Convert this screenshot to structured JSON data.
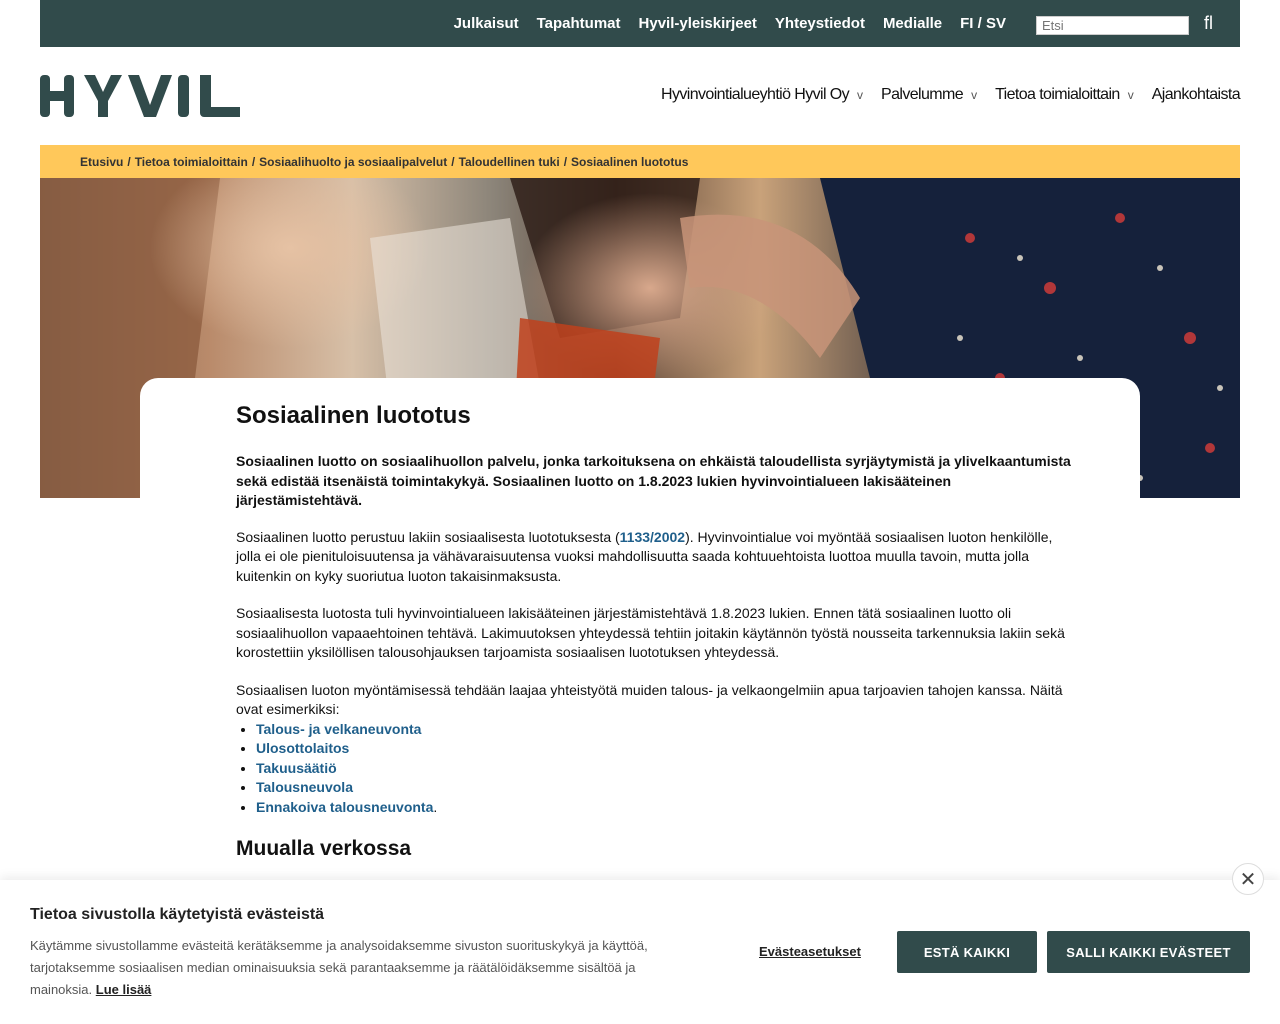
{
  "topnav": {
    "links": [
      "Julkaisut",
      "Tapahtumat",
      "Hyvil-yleiskirjeet",
      "Yhteystiedot",
      "Medialle"
    ],
    "lang_fi": "FI",
    "lang_sep": "/",
    "lang_sv": "SV",
    "search_placeholder": "Etsi",
    "search_icon": "fl"
  },
  "logo": {
    "text": "HYVIL",
    "color": "#314b4b"
  },
  "mainnav": {
    "items": [
      {
        "label": "Hyvinvointialueyhtiö Hyvil Oy",
        "chev": "v"
      },
      {
        "label": "Palvelumme",
        "chev": "v"
      },
      {
        "label": "Tietoa toimialoittain",
        "chev": "v"
      },
      {
        "label": "Ajankohtaista"
      }
    ]
  },
  "breadcrumb": {
    "items": [
      "Etusivu",
      "Tietoa toimialoittain",
      "Sosiaalihuolto ja sosiaalipalvelut",
      "Taloudellinen tuki",
      "Sosiaalinen luototus"
    ],
    "sep": "/"
  },
  "article": {
    "title": "Sosiaalinen luototus",
    "lead": "Sosiaalinen luotto on sosiaalihuollon palvelu, jonka tarkoituksena on ehkäistä taloudellista syrjäytymistä ja ylivelkaantumista sekä edistää itsenäistä toimintakykyä. Sosiaalinen luotto on 1.8.2023 lukien hyvinvointialueen lakisääteinen järjestämistehtävä.",
    "p1_before": "Sosiaalinen luotto perustuu lakiin sosiaalisesta luototuksesta (",
    "p1_link": "1133/2002",
    "p1_after": "). Hyvinvointialue voi myöntää sosiaalisen luoton henkilölle, jolla ei ole pienituloisuutensa ja vähävaraisuutensa vuoksi mahdollisuutta saada kohtuuehtoista luottoa muulla tavoin, mutta jolla kuitenkin on kyky suoriutua luoton takaisinmaksusta.",
    "p2": "Sosiaalisesta luotosta tuli hyvinvointialueen lakisääteinen järjestämistehtävä 1.8.2023 lukien. Ennen tätä sosiaalinen luotto oli sosiaalihuollon vapaaehtoinen tehtävä. Lakimuutoksen yhteydessä tehtiin joitakin käytännön työstä nousseita tarkennuksia lakiin sekä korostettiin yksilöllisen talousohjauksen tarjoamista sosiaalisen luototuksen yhteydessä.",
    "p3": "Sosiaalisen luoton myöntämisessä tehdään laajaa yhteistyötä muiden talous- ja velkaongelmiin apua tarjoavien tahojen kanssa.  Näitä ovat esimerkiksi:",
    "links": [
      "Talous- ja velkaneuvonta",
      "Ulosottolaitos",
      "Takuusäätiö",
      "Talousneuvola",
      "Ennakoiva talousneuvonta"
    ],
    "last_punct": ".",
    "h2": "Muualla verkossa"
  },
  "cookie": {
    "title": "Tietoa sivustolla käytetyistä evästeistä",
    "text": "Käytämme sivustollamme evästeitä kerätäksemme ja analysoidaksemme sivuston suorituskykyä ja käyttöä, tarjotaksemme sosiaalisen median ominaisuuksia sekä parantaaksemme ja räätälöidäksemme sisältöä ja mainoksia.",
    "more": "Lue lisää",
    "settings": "Evästeasetukset",
    "deny": "ESTÄ KAIKKI",
    "allow": "SALLI KAIKKI EVÄSTEET",
    "close": "✕"
  },
  "colors": {
    "topbar": "#314b4b",
    "breadcrumb_bg": "#ffc85a",
    "link": "#1f5f8b"
  }
}
